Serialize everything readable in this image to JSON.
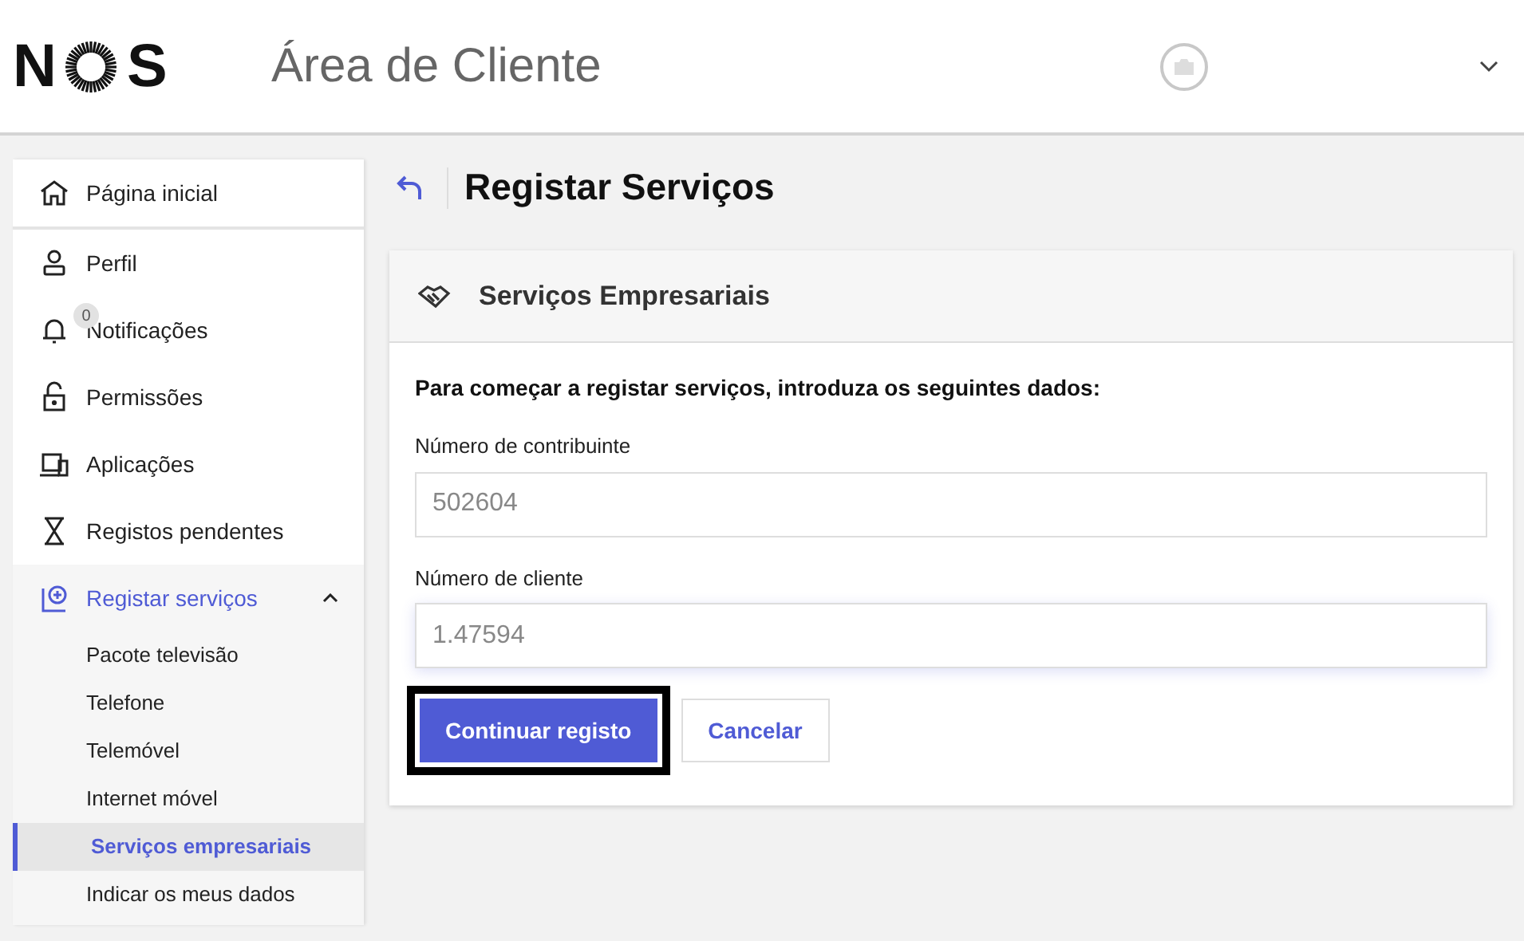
{
  "header": {
    "logo": {
      "left": "N",
      "right": "S"
    },
    "title": "Área de Cliente"
  },
  "sidebar": {
    "items": [
      {
        "label": "Página inicial",
        "selected": false
      },
      {
        "label": "Perfil",
        "selected": false
      },
      {
        "label": "Notificações",
        "selected": false,
        "badge": "0"
      },
      {
        "label": "Permissões",
        "selected": false
      },
      {
        "label": "Aplicações",
        "selected": false
      },
      {
        "label": "Registos pendentes",
        "selected": false
      },
      {
        "label": "Registar serviços",
        "selected": true,
        "expanded": true,
        "children": [
          {
            "label": "Pacote televisão",
            "selected": false
          },
          {
            "label": "Telefone",
            "selected": false
          },
          {
            "label": "Telemóvel",
            "selected": false
          },
          {
            "label": "Internet móvel",
            "selected": false
          },
          {
            "label": "Serviços empresariais",
            "selected": true
          },
          {
            "label": "Indicar os meus dados",
            "selected": false
          }
        ]
      }
    ]
  },
  "page": {
    "title": "Registar Serviços"
  },
  "card": {
    "title": "Serviços Empresariais",
    "intro": "Para começar a registar serviços, introduza os seguintes dados:",
    "fields": [
      {
        "label": "Número de contribuinte",
        "value": "502604",
        "focused": false
      },
      {
        "label": "Número de cliente",
        "value": "1.47594",
        "focused": true
      }
    ],
    "buttons": [
      {
        "label": "Continuar registo",
        "kind": "primary",
        "focused": true
      },
      {
        "label": "Cancelar",
        "kind": "secondary",
        "focused": false
      }
    ]
  }
}
